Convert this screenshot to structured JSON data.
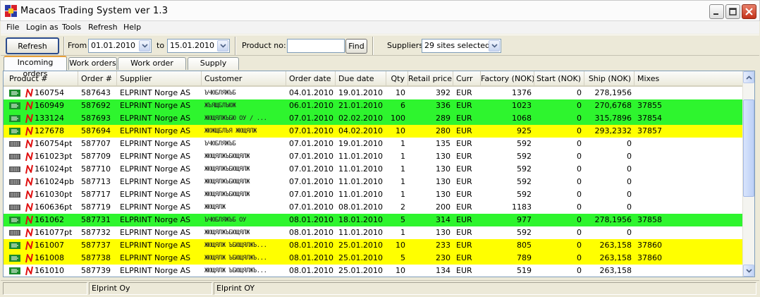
{
  "window": {
    "title": "Macaos Trading System ver 1.3"
  },
  "menu": [
    "File",
    "Login as",
    "Tools",
    "Refresh",
    "Help"
  ],
  "toolbar": {
    "refresh_label": "Refresh",
    "from_label": "From",
    "from_value": "01.01.2010",
    "to_label": "to",
    "to_value": "15.01.2010",
    "product_label": "Product no:",
    "product_value": "",
    "find_label": "Find",
    "suppliers_label": "Suppliers",
    "suppliers_value": "29 sites selected"
  },
  "tabs": [
    "Incoming orders",
    "Work orders",
    "Work order status",
    "Supply chains"
  ],
  "columns": [
    "Product #",
    "Order #",
    "Supplier",
    "Customer",
    "Order date",
    "Due date",
    "Qty",
    "Retail price",
    "Curr",
    "Factory (NOK)",
    "Start (NOK)",
    "Ship (NOK)",
    "Mixes"
  ],
  "colors": {
    "green": "#2ef52e",
    "yellow": "#ffff00",
    "white": "#ffffff"
  },
  "rows": [
    {
      "status": "truck",
      "color": "white",
      "product": "160754",
      "order": "587643",
      "supplier": "ELPRINT Norge  AS",
      "customer": "ЪЧЮБЛЯЖЪБ",
      "order_date": "04.01.2010",
      "due_date": "19.01.2010",
      "qty": "10",
      "retail": "392",
      "curr": "EUR",
      "factory": "1376",
      "start": "0",
      "ship": "278,1956",
      "mixes": ""
    },
    {
      "status": "truck",
      "color": "green",
      "product": "160949",
      "order": "587692",
      "supplier": "ELPRINT Norge  AS",
      "customer": "ЖЪЯЩБЛЪЮЖ",
      "order_date": "06.01.2010",
      "due_date": "21.01.2010",
      "qty": "6",
      "retail": "336",
      "curr": "EUR",
      "factory": "1023",
      "start": "0",
      "ship": "270,6768",
      "mixes": "37855"
    },
    {
      "status": "truck",
      "color": "green",
      "product": "133124",
      "order": "587693",
      "supplier": "ELPRINT Norge  AS",
      "customer": "ЖЮЩЯЛЖЪБЮ ОУ / ...",
      "order_date": "07.01.2010",
      "due_date": "02.02.2010",
      "qty": "100",
      "retail": "289",
      "curr": "EUR",
      "factory": "1068",
      "start": "0",
      "ship": "315,7896",
      "mixes": "37854"
    },
    {
      "status": "truck",
      "color": "yellow",
      "product": "127678",
      "order": "587694",
      "supplier": "ELPRINT Norge  AS",
      "customer": "ЖЮЖЩБЛЪЯ ЖЮЩЯЛЖ",
      "order_date": "07.01.2010",
      "due_date": "04.02.2010",
      "qty": "10",
      "retail": "280",
      "curr": "EUR",
      "factory": "925",
      "start": "0",
      "ship": "293,2332",
      "mixes": "37857"
    },
    {
      "status": "kbd",
      "color": "white",
      "product": "160754pt",
      "order": "587707",
      "supplier": "ELPRINT Norge  AS",
      "customer": "ЪЧЮБЛЯЖЪБ",
      "order_date": "07.01.2010",
      "due_date": "19.01.2010",
      "qty": "1",
      "retail": "135",
      "curr": "EUR",
      "factory": "592",
      "start": "0",
      "ship": "0",
      "mixes": ""
    },
    {
      "status": "kbd",
      "color": "white",
      "product": "161023pt",
      "order": "587709",
      "supplier": "ELPRINT Norge  AS",
      "customer": "ЖЮЩЯЛЖЪБЮЩЯЛЖ",
      "order_date": "07.01.2010",
      "due_date": "11.01.2010",
      "qty": "1",
      "retail": "130",
      "curr": "EUR",
      "factory": "592",
      "start": "0",
      "ship": "0",
      "mixes": ""
    },
    {
      "status": "kbd",
      "color": "white",
      "product": "161024pt",
      "order": "587710",
      "supplier": "ELPRINT Norge  AS",
      "customer": "ЖЮЩЯЛЖЪБЮЩЯЛЖ",
      "order_date": "07.01.2010",
      "due_date": "11.01.2010",
      "qty": "1",
      "retail": "130",
      "curr": "EUR",
      "factory": "592",
      "start": "0",
      "ship": "0",
      "mixes": ""
    },
    {
      "status": "kbd",
      "color": "white",
      "product": "161024pb",
      "order": "587713",
      "supplier": "ELPRINT Norge  AS",
      "customer": "ЖЮЩЯЛЖЪБЮЩЯЛЖ",
      "order_date": "07.01.2010",
      "due_date": "11.01.2010",
      "qty": "1",
      "retail": "130",
      "curr": "EUR",
      "factory": "592",
      "start": "0",
      "ship": "0",
      "mixes": ""
    },
    {
      "status": "kbd",
      "color": "white",
      "product": "161030pt",
      "order": "587717",
      "supplier": "ELPRINT Norge  AS",
      "customer": "ЖЮЩЯЛЖЪБЮЩЯЛЖ",
      "order_date": "07.01.2010",
      "due_date": "11.01.2010",
      "qty": "1",
      "retail": "130",
      "curr": "EUR",
      "factory": "592",
      "start": "0",
      "ship": "0",
      "mixes": ""
    },
    {
      "status": "kbd",
      "color": "white",
      "product": "160636pt",
      "order": "587719",
      "supplier": "ELPRINT Norge  AS",
      "customer": "ЖЮЩЯЛЖ",
      "order_date": "07.01.2010",
      "due_date": "08.01.2010",
      "qty": "2",
      "retail": "200",
      "curr": "EUR",
      "factory": "1183",
      "start": "0",
      "ship": "0",
      "mixes": ""
    },
    {
      "status": "truck",
      "color": "green",
      "product": "161062",
      "order": "587731",
      "supplier": "ELPRINT Norge  AS",
      "customer": "ЪЧЮБЛЯЖЪБ ОУ",
      "order_date": "08.01.2010",
      "due_date": "18.01.2010",
      "qty": "5",
      "retail": "314",
      "curr": "EUR",
      "factory": "977",
      "start": "0",
      "ship": "278,1956",
      "mixes": "37858"
    },
    {
      "status": "kbd",
      "color": "white",
      "product": "161077pt",
      "order": "587732",
      "supplier": "ELPRINT Norge  AS",
      "customer": "ЖЮЩЯЛЖЪБЮЩЯЛЖ",
      "order_date": "08.01.2010",
      "due_date": "11.01.2010",
      "qty": "1",
      "retail": "130",
      "curr": "EUR",
      "factory": "592",
      "start": "0",
      "ship": "0",
      "mixes": ""
    },
    {
      "status": "truck",
      "color": "yellow",
      "product": "161007",
      "order": "587737",
      "supplier": "ELPRINT Norge  AS",
      "customer": "ЖЮЩЯЛЖ ЪБЮЩЯЛЖЪ...",
      "order_date": "08.01.2010",
      "due_date": "25.01.2010",
      "qty": "10",
      "retail": "233",
      "curr": "EUR",
      "factory": "805",
      "start": "0",
      "ship": "263,158",
      "mixes": "37860"
    },
    {
      "status": "truck",
      "color": "yellow",
      "product": "161008",
      "order": "587738",
      "supplier": "ELPRINT Norge  AS",
      "customer": "ЖЮЩЯЛЖ ЪБЮЩЯЛЖЪ...",
      "order_date": "08.01.2010",
      "due_date": "25.01.2010",
      "qty": "5",
      "retail": "230",
      "curr": "EUR",
      "factory": "789",
      "start": "0",
      "ship": "263,158",
      "mixes": "37860"
    },
    {
      "status": "truck",
      "color": "white",
      "product": "161010",
      "order": "587739",
      "supplier": "ELPRINT Norge  AS",
      "customer": "ЖЮЩЯЛЖ ЪБЮЩЯЛЖЪ...",
      "order_date": "08.01.2010",
      "due_date": "25.01.2010",
      "qty": "10",
      "retail": "134",
      "curr": "EUR",
      "factory": "519",
      "start": "0",
      "ship": "263,158",
      "mixes": ""
    }
  ],
  "statusbar": {
    "panel1": "",
    "panel2": "Elprint Oy",
    "panel3": "Elprint OY"
  }
}
